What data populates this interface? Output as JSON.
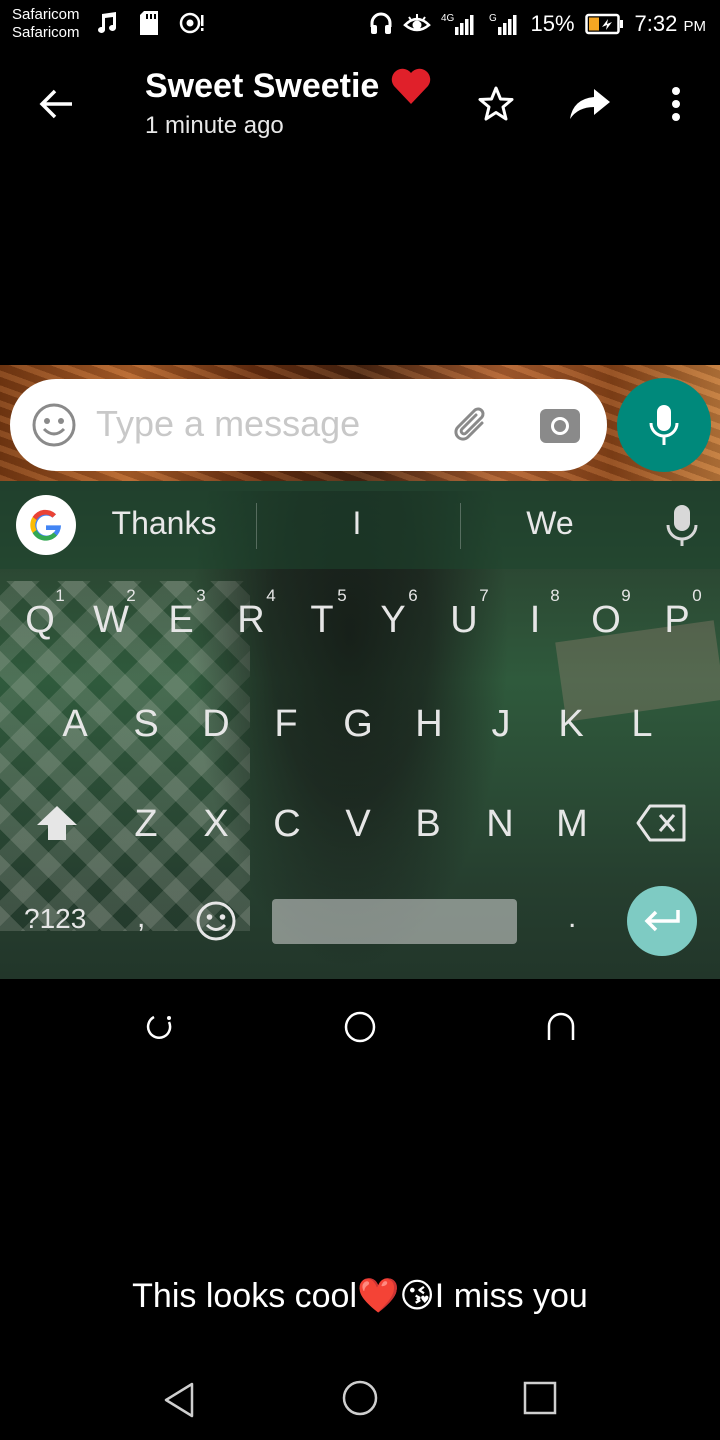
{
  "status_bar": {
    "carrier_line1": "Safaricom",
    "carrier_line2": "Safaricom",
    "battery_percent": "15%",
    "time": "7:32",
    "time_suffix": "PM"
  },
  "header": {
    "title": "Sweet Sweetie",
    "title_emoji": "❤️",
    "subtitle": "1 minute ago"
  },
  "composer": {
    "placeholder": "Type a message"
  },
  "keyboard": {
    "suggestions": [
      "Thanks",
      "I",
      "We"
    ],
    "row1": [
      "Q",
      "W",
      "E",
      "R",
      "T",
      "Y",
      "U",
      "I",
      "O",
      "P"
    ],
    "row1_numbers": [
      "1",
      "2",
      "3",
      "4",
      "5",
      "6",
      "7",
      "8",
      "9",
      "0"
    ],
    "row2": [
      "A",
      "S",
      "D",
      "F",
      "G",
      "H",
      "J",
      "K",
      "L"
    ],
    "row3": [
      "Z",
      "X",
      "C",
      "V",
      "B",
      "N",
      "M"
    ],
    "symbols_label": "?123",
    "comma": ",",
    "period": "."
  },
  "caption": "This looks cool❤️😘I miss you",
  "colors": {
    "accent_teal": "#00897b",
    "enter_key": "#7ecbc3",
    "heart_red": "#e0202a"
  }
}
